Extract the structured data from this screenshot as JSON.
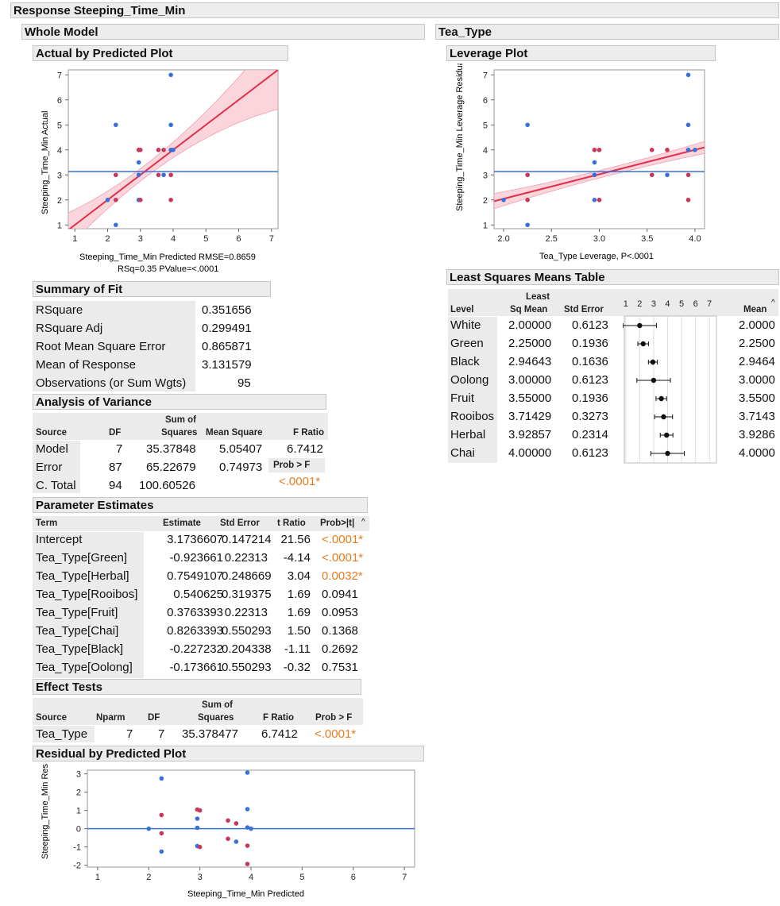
{
  "report": {
    "title": "Response Steeping_Time_Min",
    "whole_model": {
      "title": "Whole Model",
      "actual_by_predicted": {
        "title": "Actual by Predicted Plot",
        "ylabel": "Steeping_Time_Min Actual",
        "xlabel": "Steeping_Time_Min Predicted RMSE=0.8659",
        "xlabel2": "RSq=0.35 PValue=<.0001"
      },
      "summary_of_fit": {
        "title": "Summary of Fit",
        "rows": [
          {
            "label": "RSquare",
            "value": "0.351656"
          },
          {
            "label": "RSquare Adj",
            "value": "0.299491"
          },
          {
            "label": "Root Mean Square Error",
            "value": "0.865871"
          },
          {
            "label": "Mean of Response",
            "value": "3.131579"
          },
          {
            "label": "Observations (or Sum Wgts)",
            "value": "95"
          }
        ]
      },
      "anova": {
        "title": "Analysis of Variance",
        "headers": {
          "source": "Source",
          "df": "DF",
          "ss1": "Sum of",
          "ss2": "Squares",
          "ms": "Mean Square",
          "f": "F Ratio",
          "prob": "Prob > F"
        },
        "rows": [
          {
            "source": "Model",
            "df": "7",
            "ss": "35.37848",
            "ms": "5.05407",
            "f": "6.7412"
          },
          {
            "source": "Error",
            "df": "87",
            "ss": "65.22679",
            "ms": "0.74973",
            "f": ""
          },
          {
            "source": "C. Total",
            "df": "94",
            "ss": "100.60526",
            "ms": "",
            "f": ""
          }
        ],
        "prob_value": "<.0001*"
      },
      "parameter_estimates": {
        "title": "Parameter Estimates",
        "headers": {
          "term": "Term",
          "est": "Estimate",
          "se": "Std Error",
          "t": "t Ratio",
          "p": "Prob>|t|"
        },
        "rows": [
          {
            "term": "Intercept",
            "est": "3.1736607",
            "se": "0.147214",
            "t": "21.56",
            "p": "<.0001*"
          },
          {
            "term": "Tea_Type[Green]",
            "est": "-0.923661",
            "se": "0.22313",
            "t": "-4.14",
            "p": "<.0001*"
          },
          {
            "term": "Tea_Type[Herbal]",
            "est": "0.7549107",
            "se": "0.248669",
            "t": "3.04",
            "p": "0.0032*"
          },
          {
            "term": "Tea_Type[Rooibos]",
            "est": "0.540625",
            "se": "0.319375",
            "t": "1.69",
            "p": "0.0941"
          },
          {
            "term": "Tea_Type[Fruit]",
            "est": "0.3763393",
            "se": "0.22313",
            "t": "1.69",
            "p": "0.0953"
          },
          {
            "term": "Tea_Type[Chai]",
            "est": "0.8263393",
            "se": "0.550293",
            "t": "1.50",
            "p": "0.1368"
          },
          {
            "term": "Tea_Type[Black]",
            "est": "-0.227232",
            "se": "0.204338",
            "t": "-1.11",
            "p": "0.2692"
          },
          {
            "term": "Tea_Type[Oolong]",
            "est": "-0.173661",
            "se": "0.550293",
            "t": "-0.32",
            "p": "0.7531"
          }
        ]
      },
      "effect_tests": {
        "title": "Effect Tests",
        "headers": {
          "source": "Source",
          "nparm": "Nparm",
          "df": "DF",
          "ss1": "Sum of",
          "ss2": "Squares",
          "f": "F Ratio",
          "p": "Prob > F"
        },
        "row": {
          "source": "Tea_Type",
          "nparm": "7",
          "df": "7",
          "ss": "35.378477",
          "f": "6.7412",
          "p": "<.0001*"
        }
      },
      "residual_plot": {
        "title": "Residual by Predicted Plot",
        "ylabel": "Steeping_Time_Min Residual",
        "xlabel": "Steeping_Time_Min Predicted"
      }
    },
    "tea_type": {
      "title": "Tea_Type",
      "leverage_plot": {
        "title": "Leverage Plot",
        "ylabel": "Steeping_Time_Min Leverage Residuals",
        "xlabel": "Tea_Type Leverage, P<.0001"
      },
      "lsmeans": {
        "title": "Least Squares Means Table",
        "headers": {
          "level": "Level",
          "lsm1": "Least",
          "lsm2": "Sq Mean",
          "se": "Std Error",
          "mean": "Mean"
        },
        "rows": [
          {
            "level": "White",
            "lsm": "2.00000",
            "se": "0.6123",
            "mean": "2.0000"
          },
          {
            "level": "Green",
            "lsm": "2.25000",
            "se": "0.1936",
            "mean": "2.2500"
          },
          {
            "level": "Black",
            "lsm": "2.94643",
            "se": "0.1636",
            "mean": "2.9464"
          },
          {
            "level": "Oolong",
            "lsm": "3.00000",
            "se": "0.6123",
            "mean": "3.0000"
          },
          {
            "level": "Fruit",
            "lsm": "3.55000",
            "se": "0.1936",
            "mean": "3.5500"
          },
          {
            "level": "Rooibos",
            "lsm": "3.71429",
            "se": "0.3273",
            "mean": "3.7143"
          },
          {
            "level": "Herbal",
            "lsm": "3.92857",
            "se": "0.2314",
            "mean": "3.9286"
          },
          {
            "level": "Chai",
            "lsm": "4.00000",
            "se": "0.6123",
            "mean": "4.0000"
          }
        ]
      }
    }
  },
  "colors": {
    "blue": "#3a6fd8",
    "red": "#c8375a",
    "fit": "#e0304a",
    "band": "#f8c8d0",
    "header": "#ececec",
    "pvalue": "#e87b1e"
  },
  "chart_data": [
    {
      "type": "scatter",
      "title": "Actual by Predicted Plot",
      "xlabel": "Steeping_Time_Min Predicted RMSE=0.8659",
      "ylabel": "Steeping_Time_Min Actual",
      "xlim": [
        0.8,
        7.2
      ],
      "ylim": [
        0.85,
        7.2
      ],
      "xticks": [
        1,
        2,
        3,
        4,
        5,
        6,
        7
      ],
      "yticks": [
        1,
        2,
        3,
        4,
        5,
        6,
        7
      ],
      "mean_line": 3.1316,
      "fit_line": {
        "x": [
          0.8,
          7.2
        ],
        "y": [
          0.8,
          7.2
        ]
      },
      "points": [
        {
          "x": 2.0,
          "y": 2,
          "c": "blue"
        },
        {
          "x": 2.25,
          "y": 5,
          "c": "blue"
        },
        {
          "x": 2.25,
          "y": 3,
          "c": "red"
        },
        {
          "x": 2.25,
          "y": 2,
          "c": "red"
        },
        {
          "x": 2.25,
          "y": 1,
          "c": "blue"
        },
        {
          "x": 2.95,
          "y": 4,
          "c": "red"
        },
        {
          "x": 3.0,
          "y": 4,
          "c": "red"
        },
        {
          "x": 2.95,
          "y": 3.5,
          "c": "blue"
        },
        {
          "x": 2.95,
          "y": 3,
          "c": "blue"
        },
        {
          "x": 2.95,
          "y": 2,
          "c": "blue"
        },
        {
          "x": 3.0,
          "y": 2,
          "c": "red"
        },
        {
          "x": 3.55,
          "y": 4,
          "c": "red"
        },
        {
          "x": 3.55,
          "y": 3,
          "c": "red"
        },
        {
          "x": 3.71,
          "y": 4,
          "c": "red"
        },
        {
          "x": 3.71,
          "y": 3,
          "c": "blue"
        },
        {
          "x": 3.93,
          "y": 7,
          "c": "blue"
        },
        {
          "x": 3.93,
          "y": 5,
          "c": "blue"
        },
        {
          "x": 3.93,
          "y": 4,
          "c": "blue"
        },
        {
          "x": 4.0,
          "y": 4,
          "c": "blue"
        },
        {
          "x": 3.93,
          "y": 3,
          "c": "red"
        },
        {
          "x": 3.93,
          "y": 2,
          "c": "red"
        }
      ]
    },
    {
      "type": "scatter",
      "title": "Leverage Plot",
      "xlabel": "Tea_Type Leverage, P<.0001",
      "ylabel": "Steeping_Time_Min Leverage Residuals",
      "xlim": [
        1.9,
        4.1
      ],
      "ylim": [
        0.85,
        7.2
      ],
      "xticks": [
        2.0,
        2.5,
        3.0,
        3.5,
        4.0
      ],
      "yticks": [
        1,
        2,
        3,
        4,
        5,
        6,
        7
      ],
      "mean_line": 3.1316,
      "fit_line": {
        "x": [
          1.9,
          4.1
        ],
        "y": [
          1.95,
          4.1
        ]
      },
      "points": [
        {
          "x": 2.0,
          "y": 2,
          "c": "blue"
        },
        {
          "x": 2.25,
          "y": 5,
          "c": "blue"
        },
        {
          "x": 2.25,
          "y": 3,
          "c": "red"
        },
        {
          "x": 2.25,
          "y": 2,
          "c": "red"
        },
        {
          "x": 2.25,
          "y": 1,
          "c": "blue"
        },
        {
          "x": 2.95,
          "y": 4,
          "c": "red"
        },
        {
          "x": 3.0,
          "y": 4,
          "c": "red"
        },
        {
          "x": 2.95,
          "y": 3.5,
          "c": "blue"
        },
        {
          "x": 2.95,
          "y": 3,
          "c": "blue"
        },
        {
          "x": 2.95,
          "y": 2,
          "c": "blue"
        },
        {
          "x": 3.0,
          "y": 2,
          "c": "red"
        },
        {
          "x": 3.55,
          "y": 4,
          "c": "red"
        },
        {
          "x": 3.55,
          "y": 3,
          "c": "red"
        },
        {
          "x": 3.71,
          "y": 4,
          "c": "red"
        },
        {
          "x": 3.71,
          "y": 3,
          "c": "blue"
        },
        {
          "x": 3.93,
          "y": 7,
          "c": "blue"
        },
        {
          "x": 3.93,
          "y": 5,
          "c": "blue"
        },
        {
          "x": 3.93,
          "y": 4,
          "c": "blue"
        },
        {
          "x": 4.0,
          "y": 4,
          "c": "blue"
        },
        {
          "x": 3.93,
          "y": 3,
          "c": "red"
        },
        {
          "x": 3.93,
          "y": 2,
          "c": "red"
        }
      ]
    },
    {
      "type": "scatter",
      "title": "Residual by Predicted Plot",
      "xlabel": "Steeping_Time_Min Predicted",
      "ylabel": "Steeping_Time_Min Residual",
      "xlim": [
        0.8,
        7.2
      ],
      "ylim": [
        -2.1,
        3.2
      ],
      "xticks": [
        1,
        2,
        3,
        4,
        5,
        6,
        7
      ],
      "yticks": [
        -2,
        -1,
        0,
        1,
        2,
        3
      ],
      "mean_line": 0,
      "points": [
        {
          "x": 2.0,
          "y": 0,
          "c": "blue"
        },
        {
          "x": 2.25,
          "y": 2.75,
          "c": "blue"
        },
        {
          "x": 2.25,
          "y": 0.75,
          "c": "red"
        },
        {
          "x": 2.25,
          "y": -0.25,
          "c": "red"
        },
        {
          "x": 2.25,
          "y": -1.25,
          "c": "blue"
        },
        {
          "x": 2.95,
          "y": 1.05,
          "c": "red"
        },
        {
          "x": 3.0,
          "y": 1.0,
          "c": "red"
        },
        {
          "x": 2.95,
          "y": 0.55,
          "c": "blue"
        },
        {
          "x": 2.95,
          "y": 0.05,
          "c": "blue"
        },
        {
          "x": 2.95,
          "y": -0.95,
          "c": "blue"
        },
        {
          "x": 3.0,
          "y": -1.0,
          "c": "red"
        },
        {
          "x": 3.55,
          "y": 0.45,
          "c": "red"
        },
        {
          "x": 3.55,
          "y": -0.55,
          "c": "red"
        },
        {
          "x": 3.71,
          "y": 0.29,
          "c": "red"
        },
        {
          "x": 3.71,
          "y": -0.71,
          "c": "blue"
        },
        {
          "x": 3.93,
          "y": 3.07,
          "c": "blue"
        },
        {
          "x": 3.93,
          "y": 1.07,
          "c": "blue"
        },
        {
          "x": 3.93,
          "y": 0.07,
          "c": "blue"
        },
        {
          "x": 4.0,
          "y": 0.0,
          "c": "blue"
        },
        {
          "x": 3.93,
          "y": -0.93,
          "c": "red"
        },
        {
          "x": 3.93,
          "y": -1.93,
          "c": "red"
        }
      ]
    },
    {
      "type": "scatter",
      "title": "Least Squares Means",
      "xlim": [
        0.9,
        7.5
      ],
      "xticks": [
        1,
        2,
        3,
        4,
        5,
        6,
        7
      ],
      "points": [
        {
          "level": "White",
          "mean": 2.0,
          "se": 0.6123
        },
        {
          "level": "Green",
          "mean": 2.25,
          "se": 0.1936
        },
        {
          "level": "Black",
          "mean": 2.94643,
          "se": 0.1636
        },
        {
          "level": "Oolong",
          "mean": 3.0,
          "se": 0.6123
        },
        {
          "level": "Fruit",
          "mean": 3.55,
          "se": 0.1936
        },
        {
          "level": "Rooibos",
          "mean": 3.71429,
          "se": 0.3273
        },
        {
          "level": "Herbal",
          "mean": 3.92857,
          "se": 0.2314
        },
        {
          "level": "Chai",
          "mean": 4.0,
          "se": 0.6123
        }
      ]
    }
  ]
}
